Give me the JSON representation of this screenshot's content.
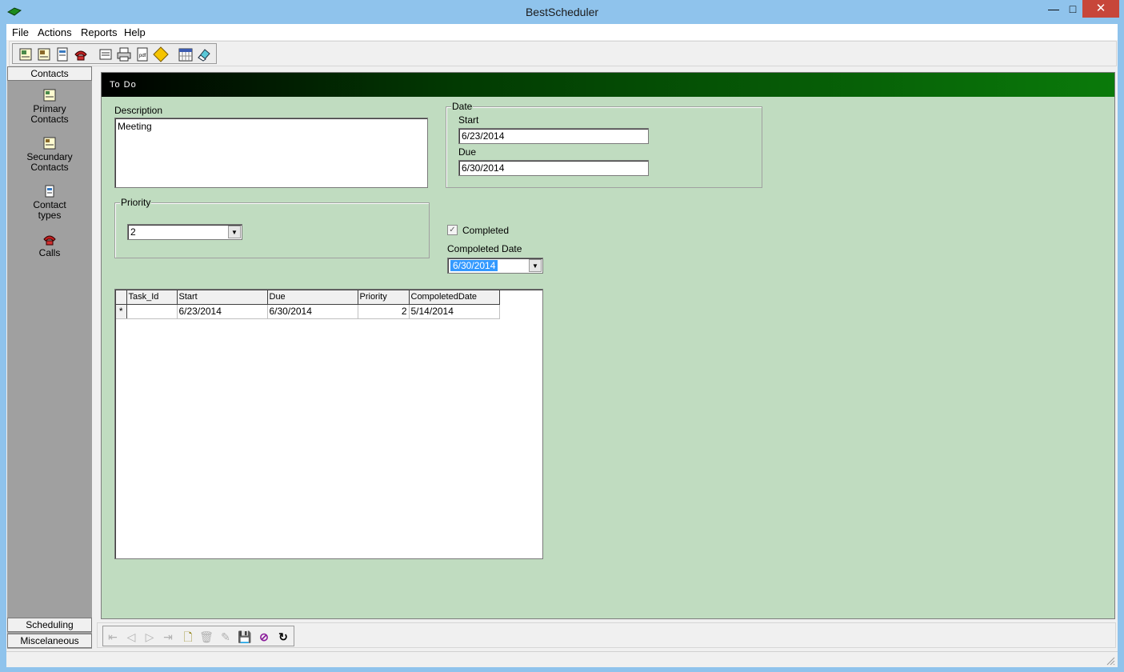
{
  "window": {
    "title": "BestScheduler",
    "close_glyph": "✕",
    "max_glyph": "□",
    "min_glyph": "—"
  },
  "menu": {
    "items": [
      "File",
      "Actions",
      "Reports",
      "Help"
    ]
  },
  "toolbar": {
    "icons": [
      "primary-contacts-icon",
      "secondary-contacts-icon",
      "contact-types-icon",
      "calls-icon",
      "appointments-icon",
      "printer-icon",
      "pdf-report-icon",
      "diamond-icon",
      "calendar-icon",
      "eraser-icon"
    ]
  },
  "sidebar": {
    "top_header": "Contacts",
    "items": [
      {
        "label_line1": "Primary",
        "label_line2": "Contacts",
        "icon": "primary-contacts-icon"
      },
      {
        "label_line1": "Secundary",
        "label_line2": "Contacts",
        "icon": "secondary-contacts-icon"
      },
      {
        "label_line1": "Contact",
        "label_line2": "types",
        "icon": "contact-types-icon"
      },
      {
        "label_line1": "Calls",
        "label_line2": "",
        "icon": "calls-icon"
      }
    ],
    "bottom_headers": [
      "Scheduling",
      "Miscelaneous"
    ]
  },
  "form": {
    "banner_title": "To Do",
    "description_label": "Description",
    "description_value": "Meeting",
    "date_group_title": "Date",
    "start_label": "Start",
    "start_value": "6/23/2014",
    "due_label": "Due",
    "due_value": "6/30/2014",
    "priority_group_title": "Priority",
    "priority_value": "2",
    "completed_label": "Completed",
    "completed_checked": true,
    "completed_check_glyph": "✓",
    "completed_date_label": "Compoleted Date",
    "completed_date_value": "6/30/2014",
    "dropdown_arrow": "▼"
  },
  "grid": {
    "columns": [
      "Task_Id",
      "Start",
      "Due",
      "Priority",
      "CompoletedDate"
    ],
    "rows": [
      {
        "marker": "*",
        "task_id": "",
        "start": "6/23/2014",
        "due": "6/30/2014",
        "priority": "2",
        "completed_date": "5/14/2014"
      }
    ]
  },
  "navigator": {
    "buttons": [
      {
        "name": "first-record-icon",
        "glyph": "⇤",
        "enabled": false
      },
      {
        "name": "previous-record-icon",
        "glyph": "◁",
        "enabled": false
      },
      {
        "name": "next-record-icon",
        "glyph": "▷",
        "enabled": false
      },
      {
        "name": "last-record-icon",
        "glyph": "⇥",
        "enabled": false
      },
      {
        "name": "new-record-icon",
        "glyph": "🗋",
        "enabled": true
      },
      {
        "name": "delete-record-icon",
        "glyph": "🗑",
        "enabled": false
      },
      {
        "name": "edit-record-icon",
        "glyph": "✎",
        "enabled": false
      },
      {
        "name": "save-record-icon",
        "glyph": "💾",
        "enabled": true
      },
      {
        "name": "cancel-edit-icon",
        "glyph": "⊘",
        "enabled": true
      },
      {
        "name": "refresh-icon",
        "glyph": "↻",
        "enabled": true
      }
    ]
  },
  "colors": {
    "titlebar": "#8fc3ec",
    "form_bg": "#c0dcc0",
    "sidebar_bg": "#a0a0a0",
    "banner_end": "#0a7a0a",
    "selection": "#3399ff",
    "close": "#c7463a"
  }
}
